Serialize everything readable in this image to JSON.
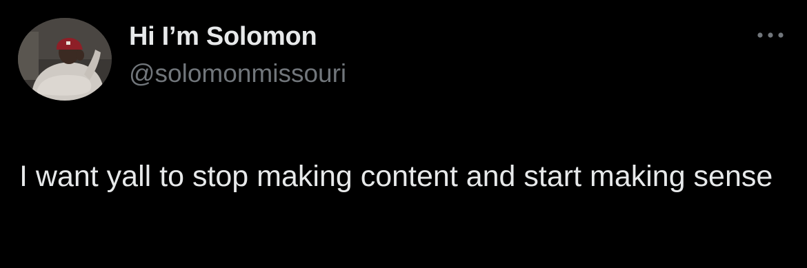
{
  "tweet": {
    "author": {
      "display_name": "Hi I’m Solomon",
      "handle": "@solomonmissouri",
      "avatar_icon": "user-avatar-photo"
    },
    "more_icon": "more-horizontal-icon",
    "text": "I want yall to stop making content and start making sense"
  },
  "colors": {
    "background": "#000000",
    "primary_text": "#e7e9ea",
    "secondary_text": "#71767b"
  }
}
